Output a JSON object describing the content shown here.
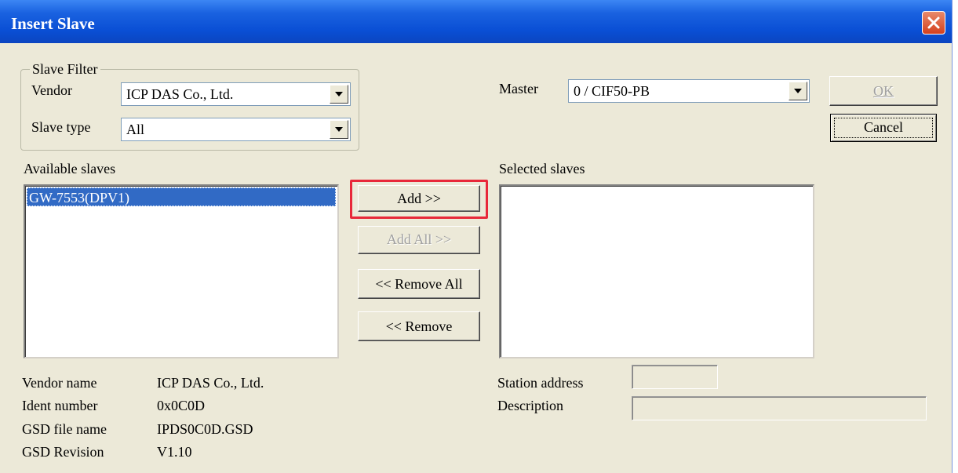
{
  "window": {
    "title": "Insert Slave"
  },
  "filter": {
    "group_label": "Slave Filter",
    "vendor_label": "Vendor",
    "vendor_value": "ICP DAS Co., Ltd.",
    "slave_type_label": "Slave type",
    "slave_type_value": "All"
  },
  "master": {
    "label": "Master",
    "value": "0 / CIF50-PB"
  },
  "buttons": {
    "ok": "OK",
    "cancel": "Cancel",
    "add": "Add >>",
    "add_all": "Add All >>",
    "remove_all": "<< Remove All",
    "remove": "<< Remove"
  },
  "available": {
    "label": "Available slaves",
    "items": [
      "GW-7553(DPV1)"
    ]
  },
  "selected": {
    "label": "Selected slaves",
    "items": []
  },
  "info": {
    "vendor_name_label": "Vendor name",
    "vendor_name_value": "ICP DAS Co., Ltd.",
    "ident_label": "Ident number",
    "ident_value": "0x0C0D",
    "gsd_file_label": "GSD file name",
    "gsd_file_value": "IPDS0C0D.GSD",
    "gsd_rev_label": "GSD Revision",
    "gsd_rev_value": "V1.10"
  },
  "station": {
    "address_label": "Station address",
    "address_value": "",
    "description_label": "Description",
    "description_value": ""
  },
  "colors": {
    "highlight": "#e8283a",
    "selection": "#316ac5",
    "titlebar": "#0a4fd5"
  },
  "icons": {
    "close": "close-icon",
    "dropdown": "chevron-down-icon"
  }
}
